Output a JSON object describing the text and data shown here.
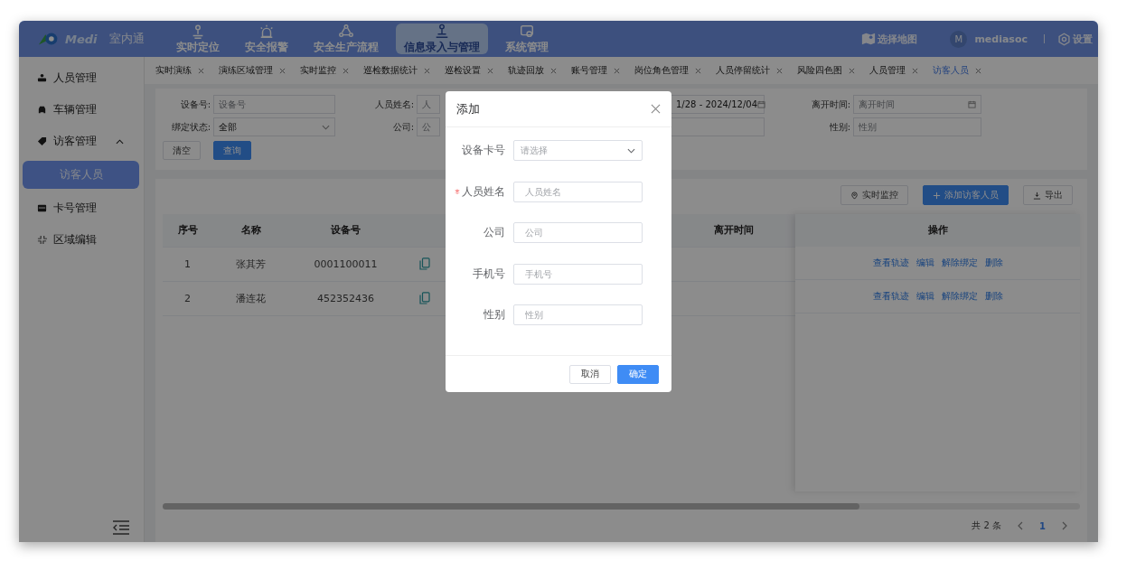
{
  "header": {
    "logo": {
      "wordmark": "Medi"
    },
    "product": "室内通",
    "nav": [
      {
        "label": "实时定位",
        "selected": false
      },
      {
        "label": "安全报警",
        "selected": false
      },
      {
        "label": "安全生产流程",
        "selected": false
      },
      {
        "label": "信息录入与管理",
        "selected": true
      },
      {
        "label": "系统管理",
        "selected": false
      }
    ],
    "map_button": "选择地图",
    "user": {
      "initial": "M",
      "name": "mediasoc"
    },
    "settings": "设置"
  },
  "sidebar": {
    "items": [
      {
        "label": "人员管理",
        "selected": false
      },
      {
        "label": "车辆管理",
        "selected": false
      },
      {
        "label": "访客管理",
        "expanded": true,
        "selected": false,
        "children": [
          {
            "label": "访客人员",
            "selected": true
          }
        ]
      },
      {
        "label": "卡号管理",
        "selected": false
      },
      {
        "label": "区域编辑",
        "selected": false
      }
    ]
  },
  "tabs": [
    {
      "label": "实时演练",
      "selected": false
    },
    {
      "label": "演练区域管理",
      "selected": false
    },
    {
      "label": "实时监控",
      "selected": false
    },
    {
      "label": "巡检数据统计",
      "selected": false
    },
    {
      "label": "巡检设置",
      "selected": false
    },
    {
      "label": "轨迹回放",
      "selected": false
    },
    {
      "label": "账号管理",
      "selected": false
    },
    {
      "label": "岗位角色管理",
      "selected": false
    },
    {
      "label": "人员停留统计",
      "selected": false
    },
    {
      "label": "风险四色图",
      "selected": false
    },
    {
      "label": "人员管理",
      "selected": false
    },
    {
      "label": "访客人员",
      "selected": true
    }
  ],
  "filters": {
    "rows": [
      [
        {
          "label": "设备号:",
          "kind": "input",
          "placeholder": "设备号"
        },
        {
          "label": "人员姓名:",
          "kind": "input",
          "placeholder": "人"
        },
        {
          "kind": "date",
          "value": "1/28 - 2024/12/04"
        },
        {
          "label": "离开时间:",
          "kind": "date",
          "placeholder": "离开时间"
        }
      ],
      [
        {
          "label": "绑定状态:",
          "kind": "select",
          "value": "全部"
        },
        {
          "label": "公司:",
          "kind": "input",
          "placeholder": "公"
        },
        {
          "kind": "input"
        },
        {
          "label": "性别:",
          "kind": "input",
          "placeholder": "性别"
        }
      ]
    ],
    "buttons": [
      {
        "label": "清空",
        "primary": false
      },
      {
        "label": "查询",
        "primary": true
      }
    ]
  },
  "toolbar": [
    {
      "label": "实时监控",
      "kind": "monitor",
      "primary": false
    },
    {
      "label": "添加访客人员",
      "kind": "add",
      "primary": true
    },
    {
      "label": "导出",
      "kind": "export",
      "primary": false
    }
  ],
  "table": {
    "columns": [
      "序号",
      "名称",
      "设备号",
      "",
      "离开时间",
      "操作"
    ],
    "rows": [
      {
        "cells": [
          "1",
          "张其芳",
          "0001100011"
        ],
        "actions": [
          "查看轨迹",
          "编辑",
          "解除绑定",
          "删除"
        ]
      },
      {
        "cells": [
          "2",
          "潘连花",
          "452352436"
        ],
        "actions": [
          "查看轨迹",
          "编辑",
          "解除绑定",
          "删除"
        ]
      }
    ]
  },
  "pagination": {
    "total": "共 2 条",
    "pages": [
      {
        "label": "1",
        "selected": true
      }
    ]
  },
  "dialog": {
    "title": "添加",
    "fields": [
      {
        "label": "设备卡号",
        "kind": "select",
        "placeholder": "请选择",
        "required": false
      },
      {
        "label": "人员姓名",
        "kind": "input",
        "placeholder": "人员姓名",
        "required": true
      },
      {
        "label": "公司",
        "kind": "input",
        "placeholder": "公司",
        "required": false
      },
      {
        "label": "手机号",
        "kind": "input",
        "placeholder": "手机号",
        "required": false
      },
      {
        "label": "性别",
        "kind": "input",
        "placeholder": "性别",
        "required": false
      }
    ],
    "buttons": [
      {
        "label": "取消",
        "primary": false
      },
      {
        "label": "确定",
        "primary": true
      }
    ]
  }
}
